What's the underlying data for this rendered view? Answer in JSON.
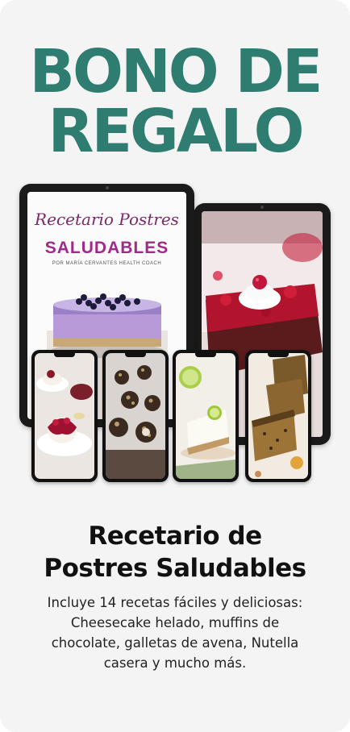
{
  "headline": {
    "line1": "BONO DE",
    "line2": "REGALO"
  },
  "cover": {
    "script_title": "Recetario Postres",
    "title": "SALUDABLES",
    "subtitle": "POR MARÍA CERVANTES HEALTH COACH"
  },
  "product": {
    "title_line1": "Recetario de",
    "title_line2": "Postres Saludables",
    "description_lines": [
      "Incluye 14 recetas fáciles y deliciosas:",
      "Cheesecake helado, muffins de",
      "chocolate, galletas de avena, Nutella",
      "casera y mucho más."
    ]
  },
  "colors": {
    "headline": "#2e7d70",
    "cover_title": "#a02a8a",
    "background": "#f4f4f4"
  },
  "images": {
    "tablet_left": "recipe-book-cover-cheesecake",
    "tablet_right": "raspberry-cream-dessert-photo",
    "phone1": "panna-cotta-berries-photo",
    "phone2": "chocolate-truffles-photo",
    "phone3": "lime-cheesecake-photo",
    "phone4": "banana-bread-photo"
  }
}
